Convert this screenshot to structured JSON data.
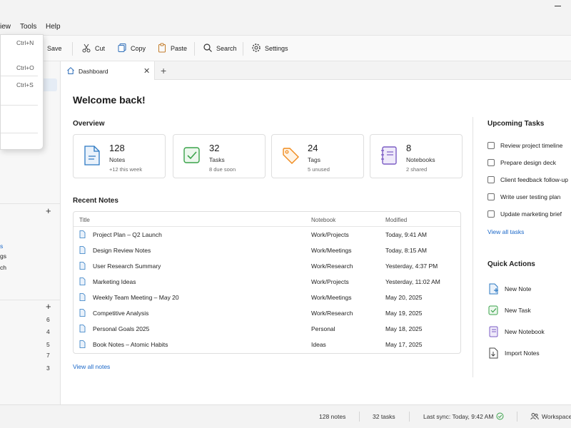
{
  "menubar": {
    "view_partial": "iew",
    "tools": "Tools",
    "help": "Help"
  },
  "file_menu": {
    "new_shortcut": "Ctrl+N",
    "open_shortcut": "Ctrl+O",
    "save_shortcut": "Ctrl+S"
  },
  "toolbar": {
    "save": "Save",
    "cut": "Cut",
    "copy": "Copy",
    "paste": "Paste",
    "search": "Search",
    "settings": "Settings"
  },
  "sidebar": {
    "item_a": "s",
    "item_b": "gs",
    "item_c": "ch",
    "counts": [
      "6",
      "4",
      "5",
      "7",
      "3"
    ]
  },
  "tab": {
    "label": "Dashboard"
  },
  "main": {
    "welcome": "Welcome back!",
    "overview_title": "Overview",
    "recent_title": "Recent Notes",
    "view_all_notes": "View all notes"
  },
  "cards": [
    {
      "value": "128",
      "label": "Notes",
      "sub": "+12 this week",
      "icon": "note-icon",
      "color": "#2b78c2"
    },
    {
      "value": "32",
      "label": "Tasks",
      "sub": "8 due soon",
      "icon": "check-icon",
      "color": "#3aa34a"
    },
    {
      "value": "24",
      "label": "Tags",
      "sub": "5 unused",
      "icon": "tag-icon",
      "color": "#f08a1c"
    },
    {
      "value": "8",
      "label": "Notebooks",
      "sub": "2 shared",
      "icon": "notebook-icon",
      "color": "#7b5cc4"
    }
  ],
  "notes_table": {
    "columns": [
      "Title",
      "Notebook",
      "Modified"
    ],
    "rows": [
      {
        "title": "Project Plan – Q2 Launch",
        "notebook": "Work/Projects",
        "modified": "Today, 9:41 AM"
      },
      {
        "title": "Design Review Notes",
        "notebook": "Work/Meetings",
        "modified": "Today, 8:15 AM"
      },
      {
        "title": "User Research Summary",
        "notebook": "Work/Research",
        "modified": "Yesterday, 4:37 PM"
      },
      {
        "title": "Marketing Ideas",
        "notebook": "Work/Projects",
        "modified": "Yesterday, 11:02 AM"
      },
      {
        "title": "Weekly Team Meeting – May 20",
        "notebook": "Work/Meetings",
        "modified": "May 20, 2025"
      },
      {
        "title": "Competitive Analysis",
        "notebook": "Work/Research",
        "modified": "May 19, 2025"
      },
      {
        "title": "Personal Goals 2025",
        "notebook": "Personal",
        "modified": "May 18, 2025"
      },
      {
        "title": "Book Notes – Atomic Habits",
        "notebook": "Ideas",
        "modified": "May 17, 2025"
      }
    ]
  },
  "upcoming": {
    "title": "Upcoming Tasks",
    "tasks": [
      "Review project timeline",
      "Prepare design deck",
      "Client feedback follow-up",
      "Write user testing plan",
      "Update marketing brief"
    ],
    "view_all": "View all tasks"
  },
  "quick_actions": {
    "title": "Quick Actions",
    "items": [
      {
        "label": "New Note",
        "icon": "new-note-icon"
      },
      {
        "label": "New Task",
        "icon": "new-task-icon"
      },
      {
        "label": "New Notebook",
        "icon": "new-notebook-icon"
      },
      {
        "label": "Import Notes",
        "icon": "import-icon"
      }
    ]
  },
  "statusbar": {
    "notes": "128 notes",
    "tasks": "32 tasks",
    "sync": "Last sync: Today, 9:42 AM",
    "workspace": "Workspace"
  },
  "colors": {
    "accent": "#1a67c8",
    "selected": "#e5ecf5",
    "sync_ok": "#3aa34a"
  }
}
